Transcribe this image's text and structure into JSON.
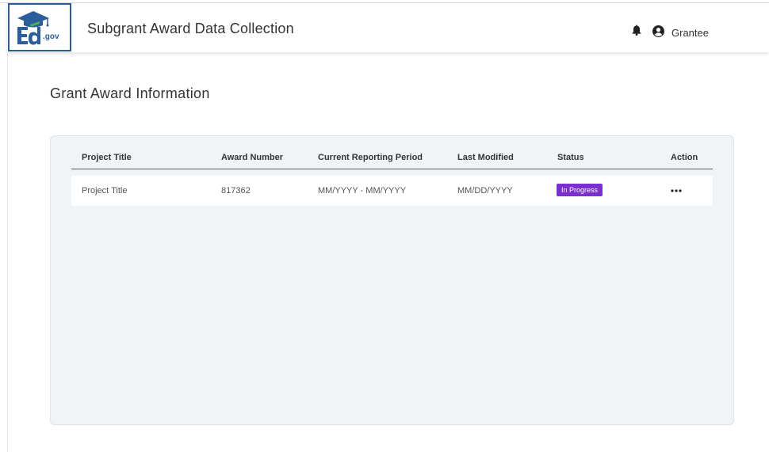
{
  "header": {
    "logo_text": ".gov",
    "app_title": "Subgrant Award Data Collection",
    "user_name": "Grantee"
  },
  "page": {
    "title": "Grant Award Information"
  },
  "table": {
    "columns": [
      "Project Title",
      "Award Number",
      "Current Reporting Period",
      "Last Modified",
      "Status",
      "Action"
    ],
    "rows": [
      {
        "project_title": "Project Title",
        "award_number": "817362",
        "reporting_period": "MM/YYYY - MM/YYYY",
        "last_modified": "MM/DD/YYYY",
        "status": "In Progress",
        "action_icon": "more-horizontal-icon"
      }
    ]
  },
  "colors": {
    "brand_blue": "#2a5d9a",
    "status_in_progress": "#7b2fd0",
    "panel_bg": "#f1f4f7"
  },
  "icons": {
    "notifications": "bell-icon",
    "account": "user-circle-icon",
    "logo": "ed-gov-logo"
  }
}
